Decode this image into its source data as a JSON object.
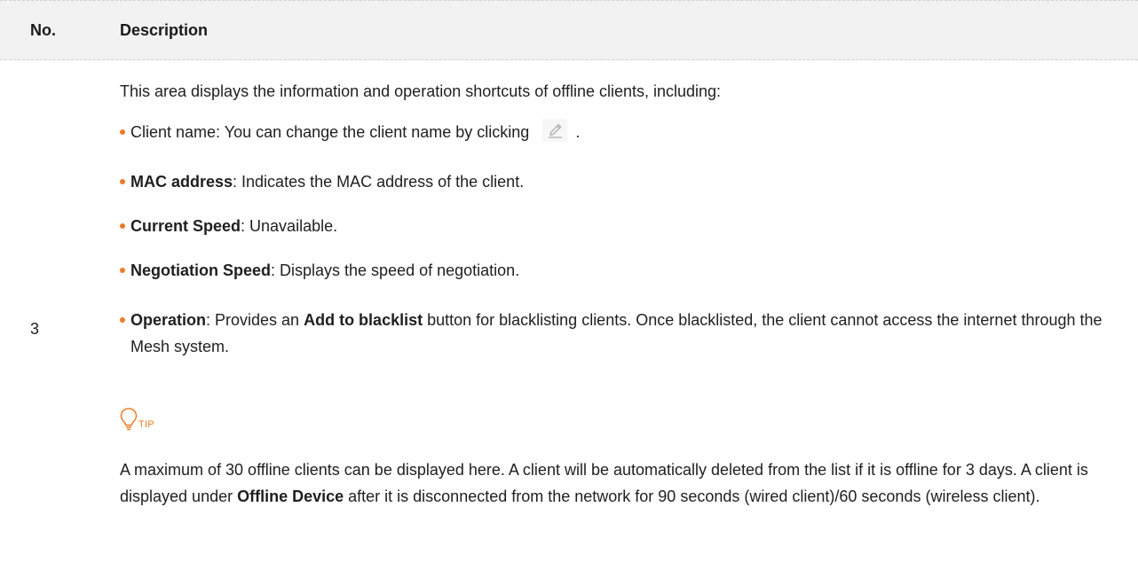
{
  "table": {
    "headers": {
      "no": "No.",
      "description": "Description"
    },
    "row": {
      "number": "3",
      "intro": "This area displays the information and operation shortcuts of offline clients, including:",
      "bullets": [
        {
          "term": "",
          "text_before": "Client name: You can change the client name by clicking",
          "text_after": "."
        },
        {
          "term": "MAC address",
          "text": ": Indicates the MAC address of the client."
        },
        {
          "term": "Current Speed",
          "text": ": Unavailable."
        },
        {
          "term": "Negotiation Speed",
          "text": ": Displays the speed of negotiation."
        },
        {
          "term": "Operation",
          "text_a": ": Provides an ",
          "term_inline": "Add to blacklist",
          "text_b": " button for blacklisting clients. Once blacklisted, the client cannot access the internet through the Mesh system."
        }
      ],
      "tip": {
        "label": "TIP",
        "text_a": "A maximum of 30 offline clients can be displayed here. A client will be automatically deleted from the list if it is offline for 3 days. A client is displayed under ",
        "term": "Offline Device",
        "text_b": " after it is disconnected from the network for 90 seconds (wired client)/60 seconds (wireless client)."
      }
    }
  },
  "colors": {
    "accent": "#f07a24",
    "header_bg": "#f2f2f2",
    "text": "#1f1f1f",
    "icon_gray": "#a8a8a8"
  },
  "icons": {
    "edit": "pencil-icon",
    "tip": "lightbulb-icon",
    "bullet": "bullet-dot"
  }
}
